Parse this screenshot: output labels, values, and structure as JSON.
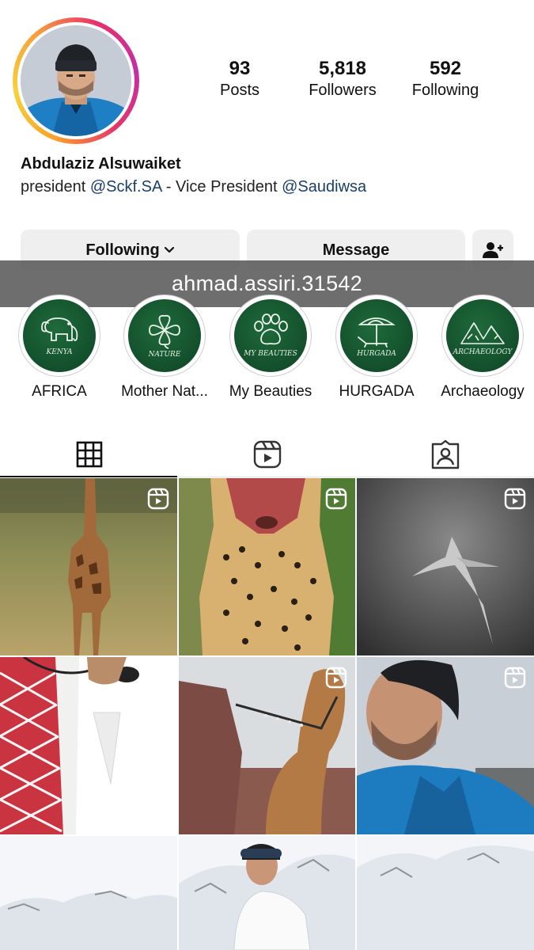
{
  "profile": {
    "name": "Abdulaziz Alsuwaiket",
    "bio_prefix": "president ",
    "bio_mention_1": "@Sckf.SA",
    "bio_middle": " - Vice President ",
    "bio_mention_2": "@Saudiwsa",
    "avatar_icon": "avatar"
  },
  "stats": {
    "posts_count": "93",
    "posts_label": "Posts",
    "followers_count": "5,818",
    "followers_label": "Followers",
    "following_count": "592",
    "following_label": "Following"
  },
  "actions": {
    "following_label": "Following",
    "message_label": "Message",
    "add_person_icon": "add-person-icon"
  },
  "overlay": {
    "text": "ahmad.assiri.31542"
  },
  "highlights": [
    {
      "label": "AFRICA",
      "caption": "KENYA",
      "icon": "elephant-icon"
    },
    {
      "label": "Mother Nat...",
      "caption": "NATURE",
      "icon": "clover-icon"
    },
    {
      "label": "My Beauties",
      "caption": "MY BEAUTIES",
      "icon": "paw-icon"
    },
    {
      "label": "HURGADA",
      "caption": "HURGADA",
      "icon": "beach-umbrella-icon"
    },
    {
      "label": "Archaeology",
      "caption": "ARCHAEOLOGY",
      "icon": "mountains-icon"
    }
  ],
  "tabs": [
    {
      "icon": "grid-icon",
      "active": true
    },
    {
      "icon": "reels-icon",
      "active": false
    },
    {
      "icon": "tagged-icon",
      "active": false
    }
  ],
  "posts": [
    {
      "subject": "giraffe",
      "is_reel": true
    },
    {
      "subject": "cheetah",
      "is_reel": true
    },
    {
      "subject": "shark",
      "is_reel": true
    },
    {
      "subject": "man-in-thobe",
      "is_reel": true
    },
    {
      "subject": "camel",
      "is_reel": true
    },
    {
      "subject": "man-in-beanie",
      "is_reel": true
    },
    {
      "subject": "snowy-mountains",
      "is_reel": false
    },
    {
      "subject": "skier",
      "is_reel": false
    },
    {
      "subject": "snowy-mountains",
      "is_reel": false
    }
  ],
  "colors": {
    "mention": "#1b3e6a",
    "button_bg": "#efefef",
    "highlight_green": "#124d2a",
    "overlay": "#5a5a5a"
  }
}
